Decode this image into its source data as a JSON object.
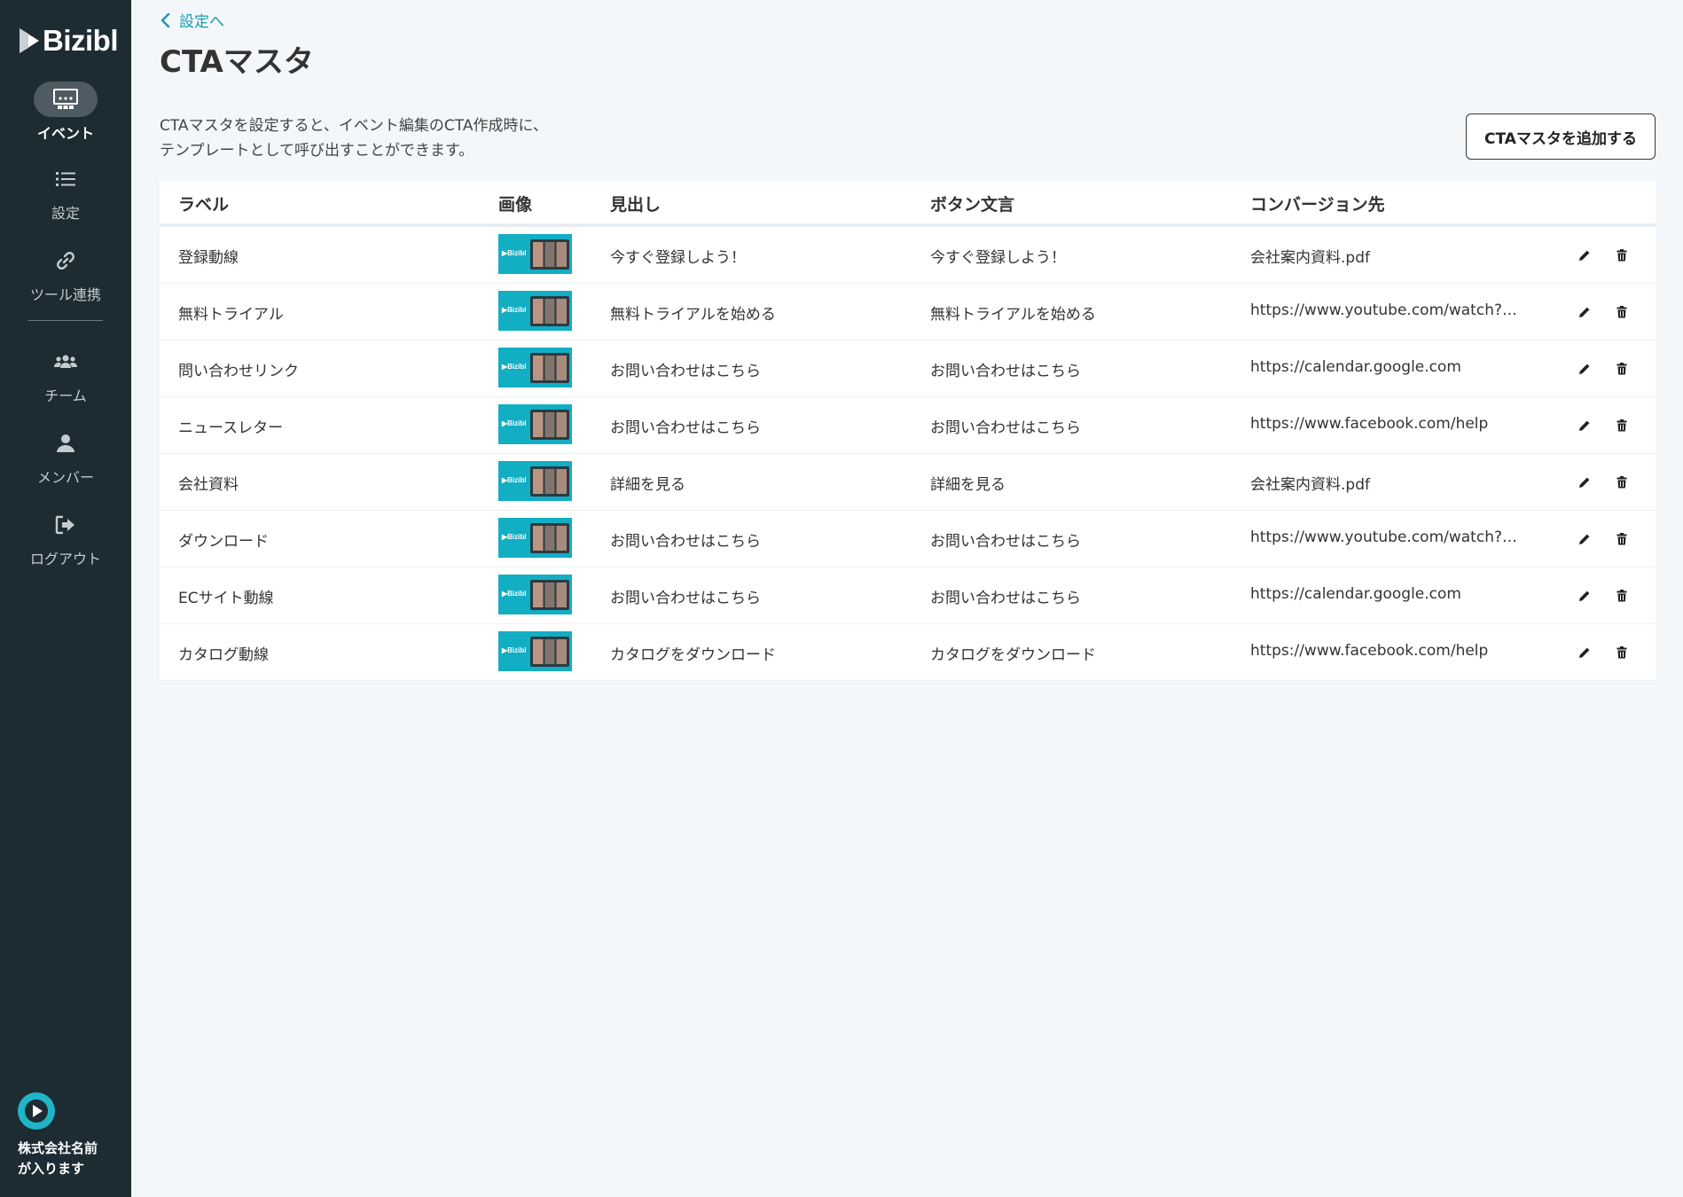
{
  "brand": {
    "name": "Bizibl"
  },
  "nav": {
    "items": [
      {
        "label": "イベント",
        "icon": "event-icon",
        "active": true
      },
      {
        "label": "設定",
        "icon": "list-icon"
      },
      {
        "label": "ツール連携",
        "icon": "link-icon"
      },
      {
        "label": "チーム",
        "icon": "team-icon"
      },
      {
        "label": "メンバー",
        "icon": "member-icon"
      },
      {
        "label": "ログアウト",
        "icon": "logout-icon"
      }
    ]
  },
  "company": {
    "name_line1": "株式会社名前",
    "name_line2": "が入ります"
  },
  "header": {
    "back_label": "設定へ",
    "title": "CTAマスタ",
    "desc_line1": "CTAマスタを設定すると、イベント編集のCTA作成時に、",
    "desc_line2": "テンプレートとして呼び出すことができます。",
    "add_button": "CTAマスタを追加する"
  },
  "table": {
    "columns": [
      "ラベル",
      "画像",
      "見出し",
      "ボタン文言",
      "コンバージョン先"
    ],
    "thumb_logo": "▶Bizibl",
    "rows": [
      {
        "label": "登録動線",
        "headline": "今すぐ登録しよう！",
        "button": "今すぐ登録しよう！",
        "conversion": "会社案内資料.pdf"
      },
      {
        "label": "無料トライアル",
        "headline": "無料トライアルを始める",
        "button": "無料トライアルを始める",
        "conversion": "https://www.youtube.com/watch?v=abcdefg"
      },
      {
        "label": "問い合わせリンク",
        "headline": "お問い合わせはこちら",
        "button": "お問い合わせはこちら",
        "conversion": "https://calendar.google.com"
      },
      {
        "label": "ニュースレター",
        "headline": "お問い合わせはこちら",
        "button": "お問い合わせはこちら",
        "conversion": "https://www.facebook.com/help"
      },
      {
        "label": "会社資料",
        "headline": "詳細を見る",
        "button": "詳細を見る",
        "conversion": "会社案内資料.pdf"
      },
      {
        "label": "ダウンロード",
        "headline": "お問い合わせはこちら",
        "button": "お問い合わせはこちら",
        "conversion": "https://www.youtube.com/watch?v=abcdefg"
      },
      {
        "label": "ECサイト動線",
        "headline": "お問い合わせはこちら",
        "button": "お問い合わせはこちら",
        "conversion": "https://calendar.google.com"
      },
      {
        "label": "カタログ動線",
        "headline": "カタログをダウンロード",
        "button": "カタログをダウンロード",
        "conversion": "https://www.facebook.com/help"
      }
    ]
  },
  "colors": {
    "sidebar_bg": "#1d2b33",
    "accent": "#1a9bb0",
    "thumb_bg": "#12aec4",
    "page_bg": "#f4f7fa"
  }
}
